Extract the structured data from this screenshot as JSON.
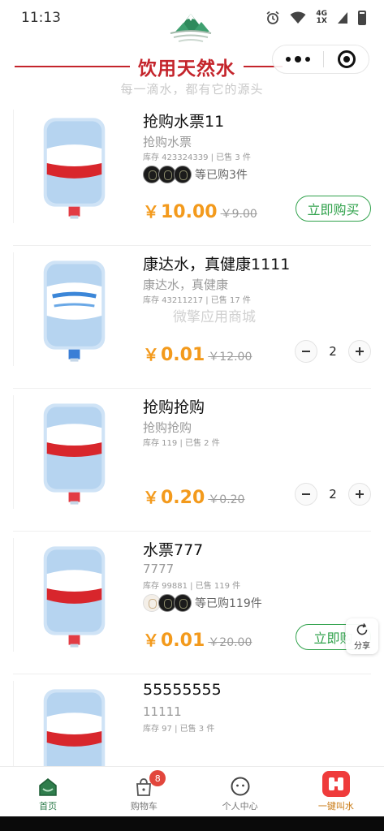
{
  "status_bar": {
    "time": "11:13",
    "network_top": "4G",
    "network_bottom": "1X"
  },
  "header": {
    "title": "饮用天然水",
    "subtitle": "每一滴水，都有它的源头",
    "brand_color": "#c4242b"
  },
  "products": [
    {
      "name": "抢购水票11",
      "desc": "抢购水票",
      "stock": "库存 423324339 | 已售 3 件",
      "buyers_text": "等已购3件",
      "price_symbol": "￥",
      "price": "10.00",
      "old_price": "￥9.00",
      "action": "立即购买"
    },
    {
      "name": "康达水，真健康1111",
      "desc": "康达水，真健康",
      "stock": "库存 43211217 | 已售 17 件",
      "price_symbol": "￥",
      "price": "0.01",
      "old_price": "￥12.00",
      "quantity": "2"
    },
    {
      "name": "抢购抢购",
      "desc": "抢购抢购",
      "stock": "库存 119 | 已售 2 件",
      "price_symbol": "￥",
      "price": "0.20",
      "old_price": "￥0.20",
      "quantity": "2"
    },
    {
      "name": "水票777",
      "desc": "7777",
      "stock": "库存 99881 | 已售 119 件",
      "buyers_text": "等已购119件",
      "price_symbol": "￥",
      "price": "0.01",
      "old_price": "￥20.00",
      "action": "立即购"
    },
    {
      "name": "55555555",
      "desc": "11111",
      "stock": "库存 97 | 已售 3 件"
    }
  ],
  "watermark": "微擎应用商城",
  "share": {
    "label": "分享",
    "icon": "refresh-share-icon"
  },
  "tabbar": {
    "home": "首页",
    "cart": "购物车",
    "cart_badge": "8",
    "profile": "个人中心",
    "order": "一键叫水"
  },
  "colors": {
    "price": "#f39a1c",
    "accent_green": "#31a24c",
    "badge_red": "#e2463c"
  }
}
